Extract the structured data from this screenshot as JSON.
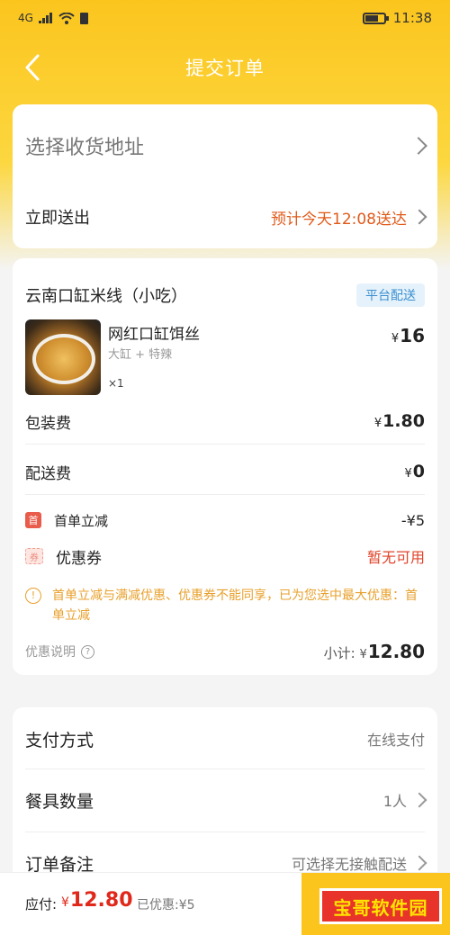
{
  "status_bar": {
    "network": "4G",
    "time": "11:38"
  },
  "nav": {
    "title": "提交订单"
  },
  "address": {
    "placeholder": "选择收货地址"
  },
  "delivery": {
    "label": "立即送出",
    "eta": "预计今天12:08送达"
  },
  "shop": {
    "name": "云南口缸米线（小吃）",
    "tag": "平台配送"
  },
  "item": {
    "name": "网红口缸饵丝",
    "spec": "大缸 + 特辣",
    "qty": "×1",
    "currency": "¥",
    "price": "16"
  },
  "fees": {
    "packaging_label": "包装费",
    "packaging_currency": "¥",
    "packaging_value": "1.80",
    "delivery_label": "配送费",
    "delivery_currency": "¥",
    "delivery_value": "0"
  },
  "discounts": {
    "first_icon": "首",
    "first_label": "首单立减",
    "first_value": "-¥5",
    "coupon_icon": "券",
    "coupon_label": "优惠券",
    "coupon_value": "暂无可用"
  },
  "notice": {
    "text": "首单立减与满减优惠、优惠券不能同享，已为您选中最大优惠：首单立减"
  },
  "summary": {
    "explain_label": "优惠说明",
    "subtotal_label": "小计:",
    "currency": "¥",
    "subtotal_value": "12.80"
  },
  "options": {
    "payment_label": "支付方式",
    "payment_value": "在线支付",
    "tableware_label": "餐具数量",
    "tableware_value": "1人",
    "remark_label": "订单备注",
    "remark_value": "可选择无接触配送"
  },
  "bottom": {
    "pay_label": "应付:",
    "currency": "¥",
    "pay_value": "12.80",
    "saved": "已优惠:¥5"
  },
  "watermark": {
    "text": "宝哥软件园"
  },
  "colors": {
    "brand_yellow": "#fbc51e",
    "price_red": "#e0281a",
    "eta_orange": "#e05a1a",
    "notice_orange": "#e8a02c"
  }
}
